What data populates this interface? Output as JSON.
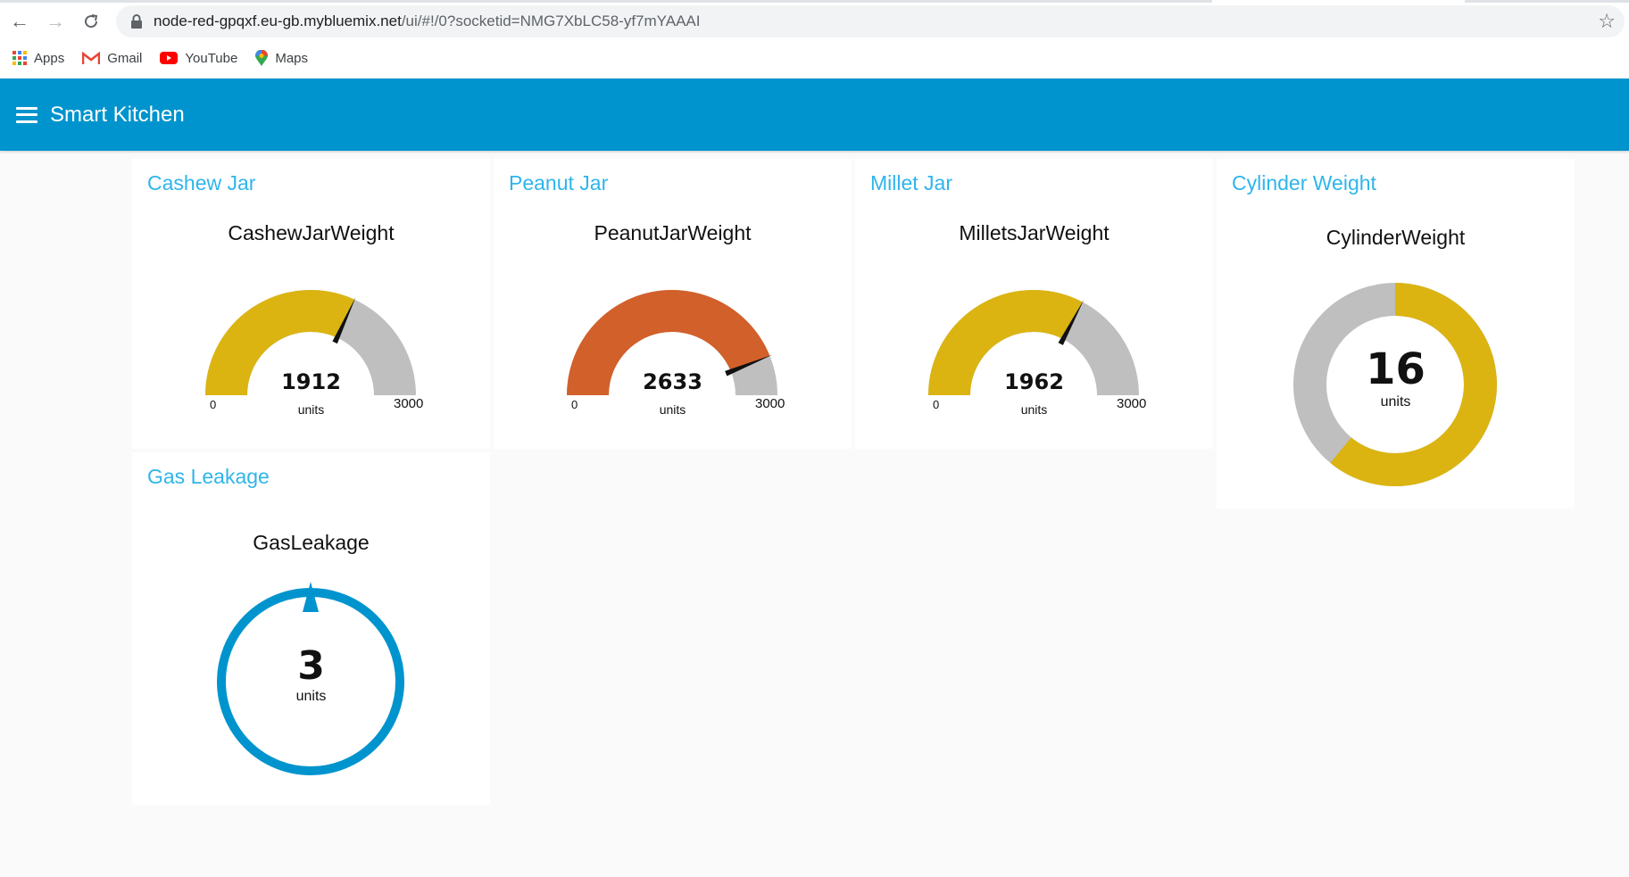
{
  "browser": {
    "url_host": "node-red-gpqxf.eu-gb.mybluemix.net",
    "url_path": "/ui/#!/0?socketid=NMG7XbLC58-yf7mYAAAI",
    "bookmarks": [
      {
        "label": "Apps",
        "icon": "apps-grid-icon"
      },
      {
        "label": "Gmail",
        "icon": "gmail-icon"
      },
      {
        "label": "YouTube",
        "icon": "youtube-icon"
      },
      {
        "label": "Maps",
        "icon": "maps-icon"
      }
    ]
  },
  "header": {
    "title": "Smart Kitchen"
  },
  "colors": {
    "accent": "#0094ce",
    "title": "#2fb5ea",
    "yellow": "#dbb412",
    "orange": "#d2602a",
    "track": "#bfbfbf",
    "blue": "#0094ce"
  },
  "cards": {
    "cashew": {
      "title": "Cashew Jar",
      "label": "CashewJarWeight",
      "value": "1912",
      "units": "units",
      "min": "0",
      "max": "3000",
      "fraction": 0.637
    },
    "peanut": {
      "title": "Peanut Jar",
      "label": "PeanutJarWeight",
      "value": "2633",
      "units": "units",
      "min": "0",
      "max": "3000",
      "fraction": 0.878
    },
    "millet": {
      "title": "Millet Jar",
      "label": "MilletsJarWeight",
      "value": "1962",
      "units": "units",
      "min": "0",
      "max": "3000",
      "fraction": 0.654
    },
    "cylinder": {
      "title": "Cylinder Weight",
      "label": "CylinderWeight",
      "value": "16",
      "units": "units",
      "fraction": 0.61
    },
    "gas": {
      "title": "Gas Leakage",
      "label": "GasLeakage",
      "value": "3",
      "units": "units",
      "fraction": 0.0
    }
  }
}
